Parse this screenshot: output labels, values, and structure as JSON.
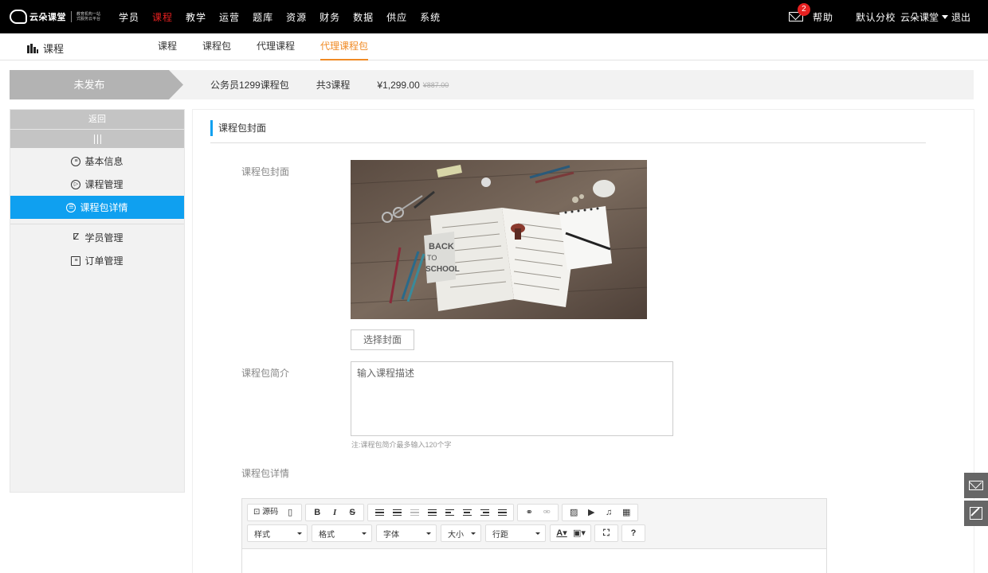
{
  "brand": {
    "name": "云朵课堂",
    "slogan": "教育机构一站式服务云平台"
  },
  "topnav": {
    "items": [
      "学员",
      "课程",
      "教学",
      "运营",
      "题库",
      "资源",
      "财务",
      "数据",
      "供应",
      "系统"
    ],
    "active_index": 1,
    "mail_badge": "2",
    "help": "帮助",
    "school": "默认分校",
    "user": "云朵课堂",
    "logout": "退出"
  },
  "subnav": {
    "section": "课程",
    "tabs": [
      "课程",
      "课程包",
      "代理课程",
      "代理课程包"
    ],
    "active_index": 3
  },
  "status": {
    "state": "未发布",
    "package_name": "公务员1299课程包",
    "course_count": "共3课程",
    "price": "¥1,299.00",
    "original_price": "¥887.00"
  },
  "leftmenu": {
    "back": "返回",
    "items": [
      {
        "label": "基本信息",
        "icon": "list-circle-icon"
      },
      {
        "label": "课程管理",
        "icon": "play-circle-icon"
      },
      {
        "label": "课程包详情",
        "icon": "detail-circle-icon",
        "active": true
      },
      {
        "label": "学员管理",
        "icon": "users-icon"
      },
      {
        "label": "订单管理",
        "icon": "order-list-icon"
      }
    ]
  },
  "main": {
    "panel_title": "课程包封面",
    "cover_label": "课程包封面",
    "select_cover_button": "选择封面",
    "intro_label": "课程包简介",
    "intro_placeholder": "输入课程描述",
    "intro_note": "注:课程包简介最多输入120个字",
    "detail_label": "课程包详情"
  },
  "editor": {
    "source_label": "源码",
    "selects": [
      "样式",
      "格式",
      "字体",
      "大小",
      "行距"
    ]
  },
  "colors": {
    "accent_blue": "#0fa0f0",
    "nav_active_red": "#e62020",
    "tab_active_orange": "#f08a24",
    "status_gray": "#b3b3b3"
  }
}
